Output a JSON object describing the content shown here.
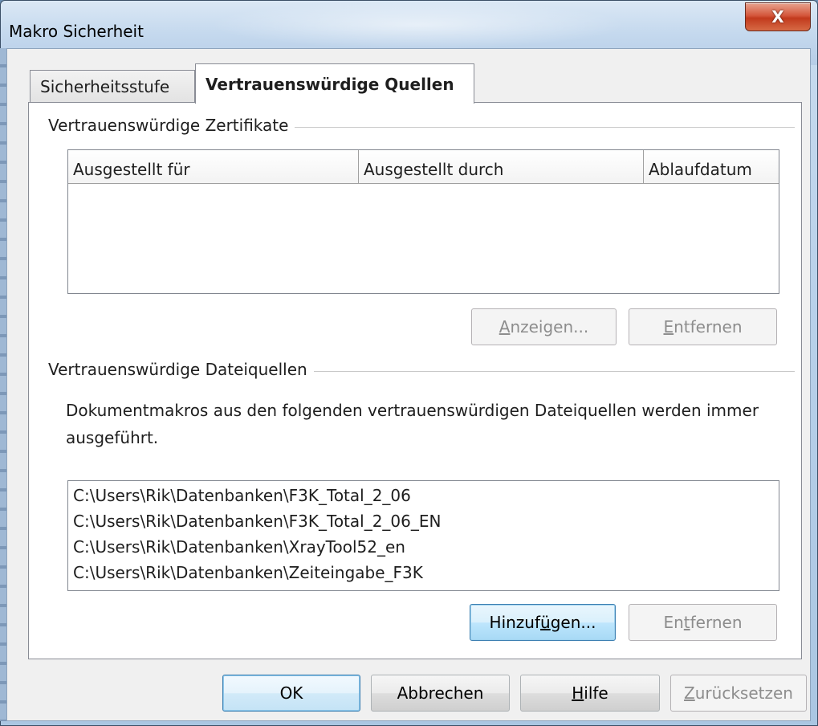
{
  "window": {
    "title": "Makro Sicherheit",
    "close_glyph": "X"
  },
  "tabs": [
    {
      "label": "Sicherheitsstufe",
      "active": false
    },
    {
      "label": "Vertrauenswürdige Quellen",
      "active": true
    }
  ],
  "certificates": {
    "group_label": "Vertrauenswürdige Zertifikate",
    "columns": [
      "Ausgestellt für",
      "Ausgestellt durch",
      "Ablaufdatum"
    ],
    "rows": [],
    "buttons": {
      "view": {
        "label": "Anzeigen...",
        "mnemonic": "A",
        "rest": "nzeigen...",
        "enabled": false
      },
      "remove": {
        "label": "Entfernen",
        "mnemonic": "E",
        "rest": "ntfernen",
        "enabled": false
      }
    }
  },
  "file_sources": {
    "group_label": "Vertrauenswürdige Dateiquellen",
    "description": "Dokumentmakros aus den folgenden vertrauenswürdigen Dateiquellen werden immer ausgeführt.",
    "items": [
      "C:\\Users\\Rik\\Datenbanken\\F3K_Total_2_06",
      "C:\\Users\\Rik\\Datenbanken\\F3K_Total_2_06_EN",
      "C:\\Users\\Rik\\Datenbanken\\XrayTool52_en",
      "C:\\Users\\Rik\\Datenbanken\\Zeiteingabe_F3K"
    ],
    "buttons": {
      "add": {
        "label": "Hinzufügen...",
        "pre": "Hinzuf",
        "mnemonic": "ü",
        "rest": "gen...",
        "enabled": true
      },
      "remove": {
        "label": "Entfernen",
        "pre": "En",
        "mnemonic": "t",
        "rest": "fernen",
        "enabled": false
      }
    }
  },
  "footer": {
    "ok": {
      "label": "OK"
    },
    "cancel": {
      "label": "Abbrechen"
    },
    "help": {
      "label": "Hilfe",
      "mnemonic": "H",
      "rest": "ilfe"
    },
    "reset": {
      "label": "Zurücksetzen",
      "mnemonic": "Z",
      "rest": "urücksetzen",
      "enabled": false
    }
  }
}
